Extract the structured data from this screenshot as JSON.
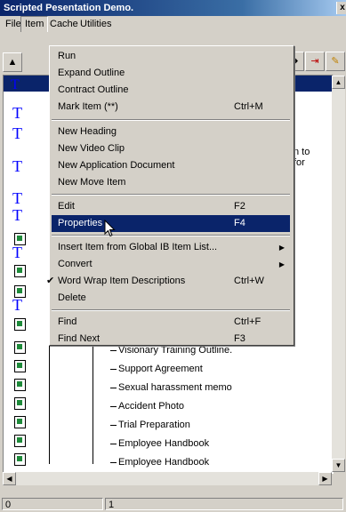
{
  "window": {
    "title": "Scripted Pesentation Demo.",
    "close_glyph": "x"
  },
  "menubar": {
    "items": [
      "File",
      "Item",
      "Cache",
      "Utilities"
    ]
  },
  "outline": {
    "header_mark": "T",
    "t_mark": "T",
    "desc_fragments": [
      "n to",
      "for"
    ],
    "items": [
      "Visionary Training Outline.",
      "Support Agreement",
      "Sexual harassment memo",
      "Accident Photo",
      "Trial Preparation",
      "Employee Handbook",
      "Employee Handbook"
    ]
  },
  "item_menu": {
    "run": "Run",
    "expand": "Expand Outline",
    "contract": "Contract Outline",
    "mark": "Mark Item (**)",
    "mark_sc": "Ctrl+M",
    "new_heading": "New Heading",
    "new_video": "New Video Clip",
    "new_app": "New Application Document",
    "new_move": "New Move Item",
    "edit": "Edit",
    "edit_sc": "F2",
    "properties": "Properties",
    "properties_sc": "F4",
    "insert": "Insert Item from Global IB Item List...",
    "convert": "Convert",
    "wordwrap": "Word Wrap Item Descriptions",
    "wordwrap_sc": "Ctrl+W",
    "delete": "Delete",
    "find": "Find",
    "find_sc": "Ctrl+F",
    "find_next": "Find Next",
    "find_next_sc": "F3"
  },
  "status": {
    "left": "0",
    "right": "1"
  }
}
